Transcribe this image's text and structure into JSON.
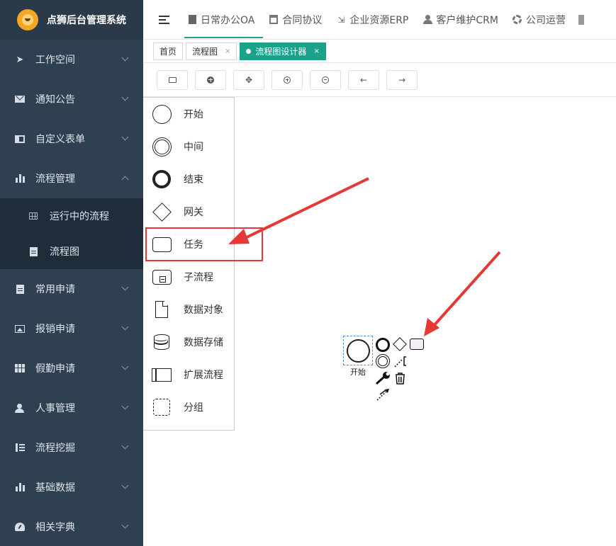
{
  "app": {
    "title": "点狮后台管理系统",
    "logo_icon": "lion-logo-icon"
  },
  "sidebar": {
    "items": [
      {
        "label": "工作空间",
        "icon": "send-icon",
        "expanded": false
      },
      {
        "label": "通知公告",
        "icon": "mail-icon",
        "expanded": false
      },
      {
        "label": "自定义表单",
        "icon": "book-icon",
        "expanded": false
      },
      {
        "label": "流程管理",
        "icon": "bar-chart-icon",
        "expanded": true,
        "children": [
          {
            "label": "运行中的流程",
            "icon": "grid-icon"
          },
          {
            "label": "流程图",
            "icon": "document-icon"
          }
        ]
      },
      {
        "label": "常用申请",
        "icon": "document-icon",
        "expanded": false
      },
      {
        "label": "报销申请",
        "icon": "image-icon",
        "expanded": false
      },
      {
        "label": "假勤申请",
        "icon": "table-icon",
        "expanded": false
      },
      {
        "label": "人事管理",
        "icon": "user-icon",
        "expanded": false
      },
      {
        "label": "流程挖掘",
        "icon": "list-icon",
        "expanded": false
      },
      {
        "label": "基础数据",
        "icon": "bar-chart-icon",
        "expanded": false
      },
      {
        "label": "相关字典",
        "icon": "gauge-icon",
        "expanded": false
      }
    ]
  },
  "topnav": {
    "tabs": [
      {
        "label": "日常办公OA",
        "icon": "document-icon",
        "active": true
      },
      {
        "label": "合同协议",
        "icon": "calendar-icon",
        "active": false
      },
      {
        "label": "企业资源ERP",
        "icon": "compress-icon",
        "active": false
      },
      {
        "label": "客户维护CRM",
        "icon": "users-icon",
        "active": false
      },
      {
        "label": "公司运营",
        "icon": "lifebuoy-icon",
        "active": false
      }
    ]
  },
  "tabs": [
    {
      "label": "首页",
      "closable": false,
      "active": false
    },
    {
      "label": "流程图",
      "closable": true,
      "active": false
    },
    {
      "label": "流程图设计器",
      "closable": true,
      "active": true
    }
  ],
  "toolbar": {
    "buttons": [
      {
        "name": "open-button",
        "icon": "folder-icon"
      },
      {
        "name": "new-button",
        "icon": "plus-circle-icon"
      },
      {
        "name": "move-button",
        "icon": "move-icon"
      },
      {
        "name": "zoom-in-button",
        "icon": "zoom-in-icon"
      },
      {
        "name": "zoom-out-button",
        "icon": "zoom-out-icon"
      },
      {
        "name": "undo-button",
        "icon": "arrow-left-icon"
      },
      {
        "name": "redo-button",
        "icon": "arrow-right-icon"
      }
    ]
  },
  "palette": {
    "items": [
      {
        "label": "开始",
        "icon": "start-event-icon"
      },
      {
        "label": "中间",
        "icon": "intermediate-event-icon"
      },
      {
        "label": "结束",
        "icon": "end-event-icon"
      },
      {
        "label": "网关",
        "icon": "gateway-icon"
      },
      {
        "label": "任务",
        "icon": "task-icon",
        "highlighted": true
      },
      {
        "label": "子流程",
        "icon": "subprocess-icon"
      },
      {
        "label": "数据对象",
        "icon": "data-object-icon"
      },
      {
        "label": "数据存储",
        "icon": "data-store-icon"
      },
      {
        "label": "扩展流程",
        "icon": "pool-icon"
      },
      {
        "label": "分组",
        "icon": "group-icon"
      }
    ]
  },
  "canvas": {
    "start_node_label": "开始",
    "context_pad": [
      "end-event-icon",
      "gateway-icon",
      "task-icon",
      "intermediate-event-icon",
      "annotation-icon",
      "wrench-icon",
      "trash-icon",
      "connect-icon"
    ]
  },
  "colors": {
    "sidebar_bg": "#2f4050",
    "accent": "#1aa38a",
    "highlight": "#e53935"
  }
}
